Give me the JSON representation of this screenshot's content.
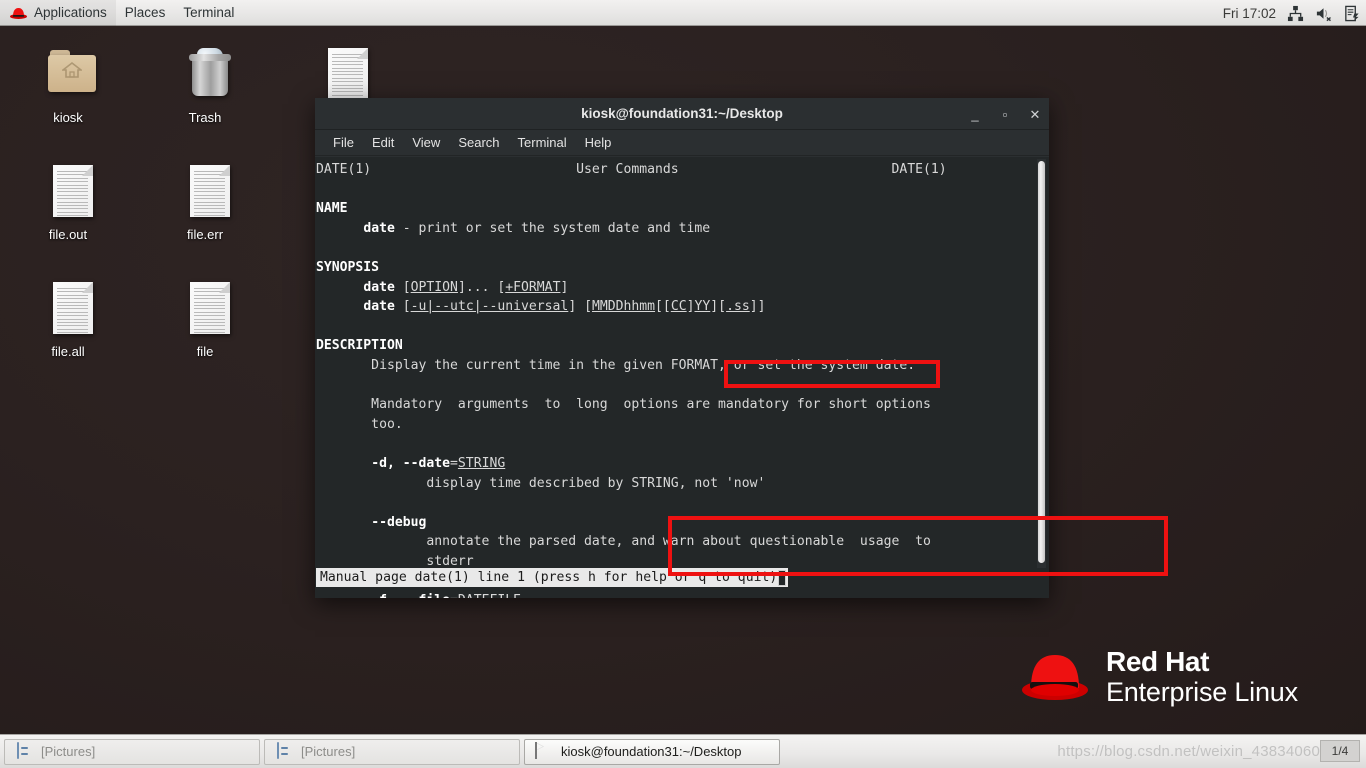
{
  "top_panel": {
    "logo_icon": "red-hat-fedora-icon",
    "menus": [
      "Applications",
      "Places",
      "Terminal"
    ],
    "clock": "Fri 17:02",
    "tray": [
      "network-icon",
      "volume-muted-icon",
      "software-update-icon"
    ]
  },
  "desktop": {
    "icons": [
      {
        "label": "kiosk",
        "icon": "home-folder-icon"
      },
      {
        "label": "Trash",
        "icon": "trash-full-icon"
      },
      {
        "label": "file.out",
        "icon": "text-document-icon"
      },
      {
        "label": "file.err",
        "icon": "text-document-icon"
      },
      {
        "label": "file.all",
        "icon": "text-document-icon"
      },
      {
        "label": "file",
        "icon": "text-document-icon"
      },
      {
        "label": "",
        "icon": "text-document-icon"
      }
    ],
    "branding": {
      "line1": "Red Hat",
      "line2": "Enterprise Linux",
      "logo_icon": "red-hat-fedora-icon",
      "logo_color": "#ee0000"
    }
  },
  "terminal": {
    "title": "kiosk@foundation31:~/Desktop",
    "menubar": [
      "File",
      "Edit",
      "View",
      "Search",
      "Terminal",
      "Help"
    ],
    "window_buttons": {
      "minimize": "_",
      "maximize": "▫",
      "close": "✕"
    },
    "status_line": "Manual page date(1) line 1 (press h for help or q to quit)",
    "man_page": {
      "header_left": "DATE(1)",
      "header_center": "User Commands",
      "header_right": "DATE(1)",
      "lines": [
        {
          "t": "NAME",
          "bold": true
        },
        {
          "t": "      date - print or set the system date and time"
        },
        {
          "t": ""
        },
        {
          "t": "SYNOPSIS",
          "bold": true
        },
        {
          "t": "      date [OPTION]... [+FORMAT]"
        },
        {
          "t": "      date [-u|--utc|--universal] [MMDDhhmm[[CC]YY][.ss]]"
        },
        {
          "t": ""
        },
        {
          "t": "DESCRIPTION",
          "bold": true
        },
        {
          "t": "       Display the current time in the given FORMAT, or set the system date."
        },
        {
          "t": ""
        },
        {
          "t": "       Mandatory  arguments  to  long  options are mandatory for short options"
        },
        {
          "t": "       too."
        },
        {
          "t": ""
        },
        {
          "t": "       -d, --date=STRING"
        },
        {
          "t": "              display time described by STRING, not 'now'"
        },
        {
          "t": ""
        },
        {
          "t": "       --debug"
        },
        {
          "t": "              annotate the parsed date, and warn about questionable  usage  to"
        },
        {
          "t": "              stderr"
        },
        {
          "t": ""
        },
        {
          "t": "       -f, --file=DATEFILE"
        }
      ]
    },
    "annotations": [
      {
        "name": "option-format-highlight",
        "color": "#ee1111"
      },
      {
        "name": "date-option-highlight",
        "color": "#ee1111"
      }
    ]
  },
  "bottom_panel": {
    "tasks": [
      {
        "label": "[Pictures]",
        "icon": "file-manager-icon",
        "state": "inactive"
      },
      {
        "label": "[Pictures]",
        "icon": "file-manager-icon",
        "state": "inactive"
      },
      {
        "label": "kiosk@foundation31:~/Desktop",
        "icon": "terminal-icon",
        "state": "active"
      }
    ],
    "workspace_indicator": "1/4",
    "watermark": "https://blog.csdn.net/weixin_43834060"
  }
}
